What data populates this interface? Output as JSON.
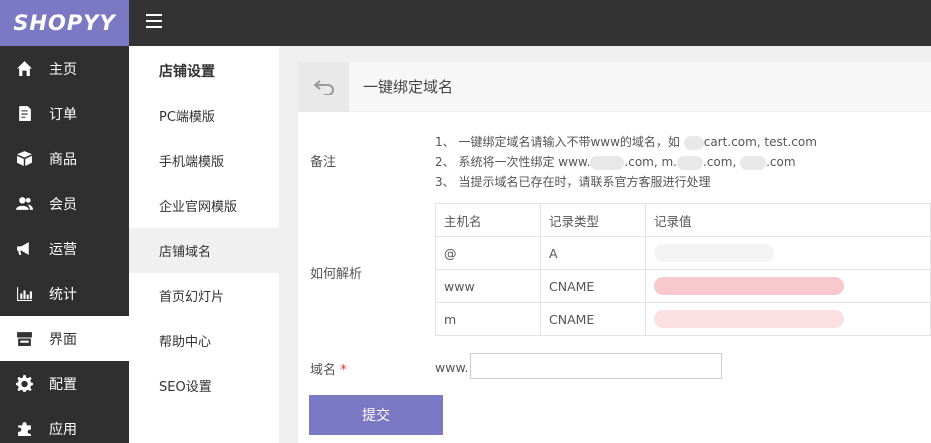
{
  "app": {
    "logo": "SHOPYY"
  },
  "sidebar": {
    "items": [
      {
        "label": "主页",
        "icon": "home-icon"
      },
      {
        "label": "订单",
        "icon": "order-icon"
      },
      {
        "label": "商品",
        "icon": "box-icon"
      },
      {
        "label": "会员",
        "icon": "users-icon"
      },
      {
        "label": "运营",
        "icon": "megaphone-icon"
      },
      {
        "label": "统计",
        "icon": "bar-chart-icon"
      },
      {
        "label": "界面",
        "icon": "store-icon",
        "active": true
      },
      {
        "label": "配置",
        "icon": "gear-icon"
      },
      {
        "label": "应用",
        "icon": "puzzle-icon"
      }
    ]
  },
  "subnav": {
    "heading": "店铺设置",
    "items": [
      "PC端模版",
      "手机端模版",
      "企业官网模版",
      "店铺域名",
      "首页幻灯片",
      "帮助中心",
      "SEO设置"
    ],
    "active_index": 3
  },
  "panel": {
    "title": "一键绑定域名",
    "notes_label": "备注",
    "notes": {
      "line1_a": "1、 一键绑定域名请输入不带www的域名，如",
      "line1_b": "cart.com, test.com",
      "line2_a": "2、 系统将一次性绑定 www.",
      "line2_b": ".com, m.",
      "line2_c": ".com,",
      "line2_d": ".com",
      "line3": "3、 当提示域名已存在时，请联系官方客服进行处理"
    },
    "resolve_label": "如何解析",
    "table": {
      "headers": [
        "主机名",
        "记录类型",
        "记录值"
      ],
      "rows": [
        {
          "host": "@",
          "type": "A"
        },
        {
          "host": "www",
          "type": "CNAME"
        },
        {
          "host": "m",
          "type": "CNAME"
        }
      ]
    },
    "domain_label": "域名",
    "required_mark": "*",
    "domain_prefix": "www.",
    "domain_value": "",
    "submit_label": "提交"
  },
  "colors": {
    "brand": "#7b78c4",
    "topbar": "#333333",
    "sidebar": "#2f2f2f"
  }
}
